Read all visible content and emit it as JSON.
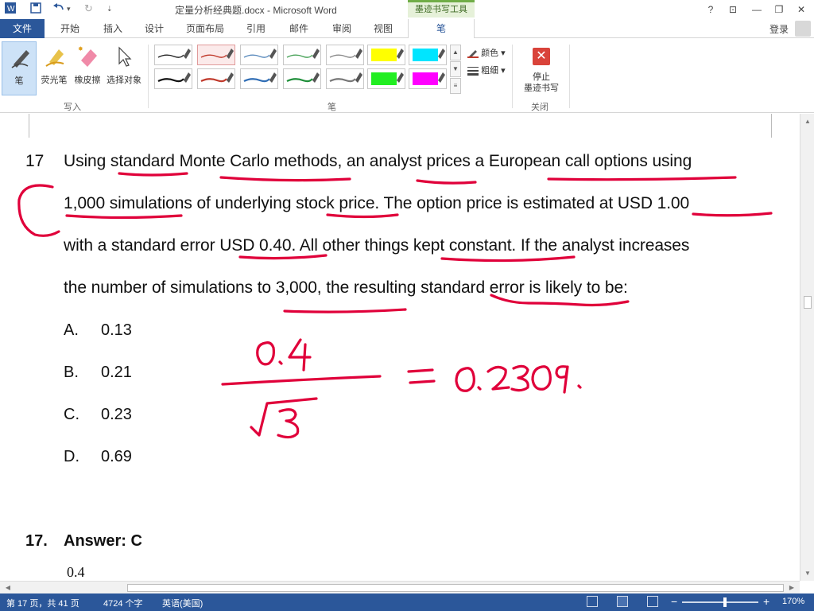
{
  "titlebar": {
    "doc_title": "定量分析经典题.docx - Microsoft Word",
    "contextual_group": "墨迹书写工具",
    "help": "?",
    "restore": "⊡",
    "minimize": "—",
    "maximize": "❐",
    "close": "✕"
  },
  "tabs": {
    "file": "文件",
    "items": [
      "开始",
      "插入",
      "设计",
      "页面布局",
      "引用",
      "邮件",
      "审阅",
      "视图"
    ],
    "active": "笔",
    "login": "登录"
  },
  "ribbon": {
    "write_tools": [
      "笔",
      "荧光笔",
      "橡皮擦",
      "选择对象"
    ],
    "write_group": "写入",
    "pens_group": "笔",
    "color_label": "颜色",
    "weight_label": "粗细",
    "stop_label_line1": "停止",
    "stop_label_line2": "墨迹书写",
    "close_group": "关闭",
    "pen_colors": {
      "row1": [
        "#222222",
        "#c0392b",
        "#5b8bbd",
        "#4aa35a",
        "#888888",
        "#ffff00",
        "#00e5ff"
      ],
      "row2": [
        "#111111",
        "#c0392b",
        "#2f6db5",
        "#1f8f3a",
        "#777777",
        "#22ee22",
        "#ff00ff"
      ]
    }
  },
  "document": {
    "question_number": "17",
    "question_lines": [
      "Using standard Monte Carlo methods, an analyst prices a European call options using",
      "1,000 simulations of underlying stock price. The option price is estimated at USD 1.00",
      "with a standard error USD 0.40. All other things kept constant. If the analyst increases",
      "the number of simulations to 3,000, the resulting standard error is likely to be:"
    ],
    "options": [
      {
        "letter": "A.",
        "value": "0.13"
      },
      {
        "letter": "B.",
        "value": "0.21"
      },
      {
        "letter": "C.",
        "value": "0.23"
      },
      {
        "letter": "D.",
        "value": "0.69"
      }
    ],
    "answer_number": "17.",
    "answer_text": "Answer: C",
    "formula_start": "0.4",
    "ink_color": "#e0003a"
  },
  "statusbar": {
    "page": "第 17 页，共 41 页",
    "words": "4724 个字",
    "language": "英语(美国)",
    "zoom": "170%",
    "zoom_minus": "−",
    "zoom_plus": "+"
  }
}
